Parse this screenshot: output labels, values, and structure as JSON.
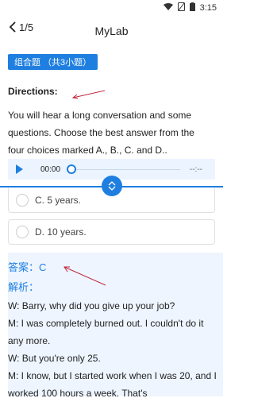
{
  "status": {
    "time": "3:15"
  },
  "header": {
    "page_counter": "1/5",
    "title": "MyLab"
  },
  "group_tag": "组合题 （共3小题）",
  "directions_label": "Directions:",
  "directions_text": "You will hear a long conversation and some questions. Choose the best answer from the four choices marked A., B., C. and D..",
  "player": {
    "current_time": "00:00",
    "end_time": "--:--"
  },
  "options": [
    {
      "label": "C. 5 years."
    },
    {
      "label": "D. 10 years."
    }
  ],
  "answer": "答案：C",
  "analysis_label": "解析：",
  "transcript": [
    "W: Barry, why did you give up your job?",
    "M: I was completely burned out. I couldn't do it any more.",
    "W: But you're only 25.",
    "M: I know, but I started work when I was 20, and I worked 100 hours a week. That's"
  ],
  "colors": {
    "accent": "#1f7fe0",
    "panel": "#eef5ff",
    "annotation": "#c0263a"
  }
}
